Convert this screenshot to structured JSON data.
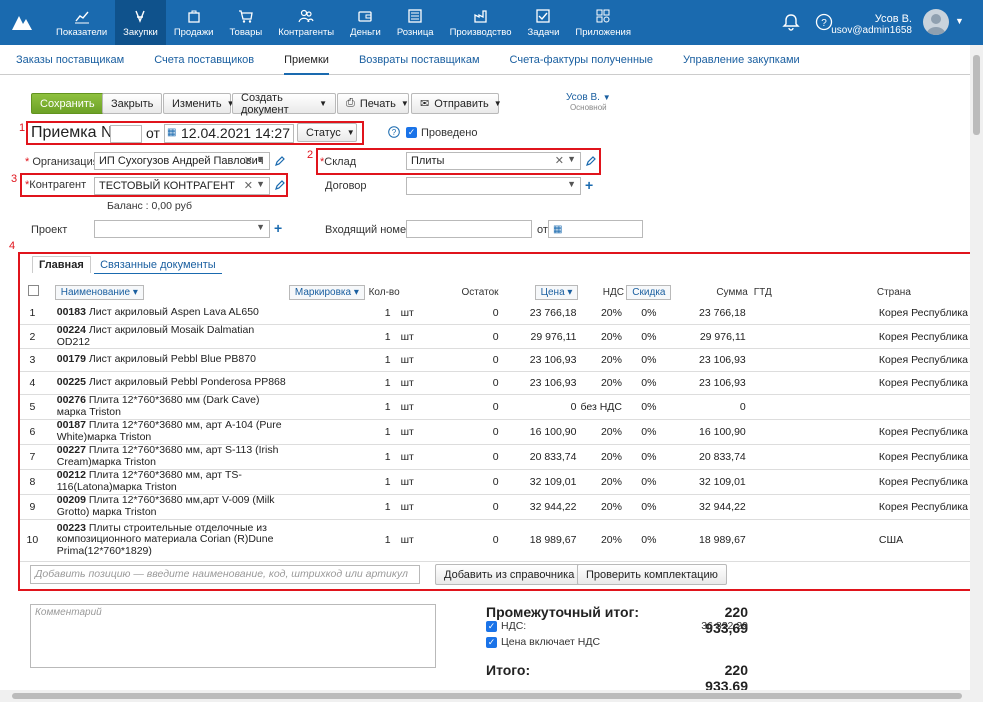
{
  "nav": {
    "items": [
      {
        "label": "Показатели",
        "icon": "chart-icon"
      },
      {
        "label": "Закупки",
        "icon": "purchases-icon"
      },
      {
        "label": "Продажи",
        "icon": "bag-icon"
      },
      {
        "label": "Товары",
        "icon": "cart-icon"
      },
      {
        "label": "Контрагенты",
        "icon": "people-icon"
      },
      {
        "label": "Деньги",
        "icon": "wallet-icon"
      },
      {
        "label": "Розница",
        "icon": "register-icon"
      },
      {
        "label": "Производство",
        "icon": "factory-icon"
      },
      {
        "label": "Задачи",
        "icon": "tasks-icon"
      },
      {
        "label": "Приложения",
        "icon": "apps-icon"
      }
    ],
    "active_index": 1,
    "user_name": "Усов В.",
    "user_login": "usov@admin1658",
    "accent": "#1a6aaf"
  },
  "subnav": [
    "Заказы поставщикам",
    "Счета поставщиков",
    "Приемки",
    "Возвраты поставщикам",
    "Счета-фактуры полученные",
    "Управление закупками"
  ],
  "toolbar": {
    "save": "Сохранить",
    "close": "Закрыть",
    "change": "Изменить",
    "create_doc": "Создать документ",
    "print": "Печать",
    "send": "Отправить",
    "user": "Усов В.",
    "user_sub": "Основной"
  },
  "markers": [
    "1",
    "2",
    "3",
    "4"
  ],
  "doc": {
    "title": "Приемка №",
    "number": "",
    "from": "от",
    "date": "12.04.2021 14:27",
    "status": "Статус",
    "posted": "Проведено",
    "org_label": "Организация",
    "org_value": "ИП Сухогузов Андрей Павлович",
    "warehouse_label": "Склад",
    "warehouse_value": "Плиты",
    "contractor_label": "Контрагент",
    "contractor_value": "ТЕСТОВЫЙ КОНТРАГЕНТ",
    "contract_label": "Договор",
    "contract_value": "",
    "balance": "Баланс : 0,00 руб",
    "project_label": "Проект",
    "project_value": "",
    "incoming_label": "Входящий номер",
    "incoming_value": "",
    "incoming_from": "от"
  },
  "tabs": [
    "Главная",
    "Связанные документы"
  ],
  "table": {
    "headers": {
      "name": "Наименование",
      "marking": "Маркировка",
      "qty": "Кол-во",
      "rest": "Остаток",
      "price": "Цена",
      "vat": "НДС",
      "discount": "Скидка",
      "sum": "Сумма",
      "gtd": "ГТД",
      "country": "Страна"
    },
    "rows": [
      {
        "n": "1",
        "code": "00183",
        "name": "Лист акриловый Aspen Lava AL650",
        "qty": "1",
        "unit": "шт",
        "rest": "0",
        "price": "23 766,18",
        "vat": "20%",
        "disc": "0%",
        "sum": "23 766,18",
        "country": "Корея Республика"
      },
      {
        "n": "2",
        "code": "00224",
        "name": "Лист акриловый Mosaik Dalmatian OD212",
        "qty": "1",
        "unit": "шт",
        "rest": "0",
        "price": "29 976,11",
        "vat": "20%",
        "disc": "0%",
        "sum": "29 976,11",
        "country": "Корея Республика"
      },
      {
        "n": "3",
        "code": "00179",
        "name": "Лист акриловый Pebbl Blue PB870",
        "qty": "1",
        "unit": "шт",
        "rest": "0",
        "price": "23 106,93",
        "vat": "20%",
        "disc": "0%",
        "sum": "23 106,93",
        "country": "Корея Республика"
      },
      {
        "n": "4",
        "code": "00225",
        "name": "Лист акриловый Pebbl Ponderosa PP868",
        "qty": "1",
        "unit": "шт",
        "rest": "0",
        "price": "23 106,93",
        "vat": "20%",
        "disc": "0%",
        "sum": "23 106,93",
        "country": "Корея Республика"
      },
      {
        "n": "5",
        "code": "00276",
        "name": "Плита 12*760*3680 мм (Dark Cave) марка Triston",
        "qty": "1",
        "unit": "шт",
        "rest": "0",
        "price": "0",
        "vat": "без НДС",
        "disc": "0%",
        "sum": "0",
        "country": ""
      },
      {
        "n": "6",
        "code": "00187",
        "name": "Плита 12*760*3680 мм, арт А-104 (Pure White)марка Triston",
        "qty": "1",
        "unit": "шт",
        "rest": "0",
        "price": "16 100,90",
        "vat": "20%",
        "disc": "0%",
        "sum": "16 100,90",
        "country": "Корея Республика"
      },
      {
        "n": "7",
        "code": "00227",
        "name": "Плита 12*760*3680 мм, арт S-113 (Irish Cream)марка Triston",
        "qty": "1",
        "unit": "шт",
        "rest": "0",
        "price": "20 833,74",
        "vat": "20%",
        "disc": "0%",
        "sum": "20 833,74",
        "country": "Корея Республика"
      },
      {
        "n": "8",
        "code": "00212",
        "name": "Плита 12*760*3680 мм, арт TS-116(Latona)марка Triston",
        "qty": "1",
        "unit": "шт",
        "rest": "0",
        "price": "32 109,01",
        "vat": "20%",
        "disc": "0%",
        "sum": "32 109,01",
        "country": "Корея Республика"
      },
      {
        "n": "9",
        "code": "00209",
        "name": "Плита 12*760*3680 мм,арт V-009 (Milk Grotto) марка Triston",
        "qty": "1",
        "unit": "шт",
        "rest": "0",
        "price": "32 944,22",
        "vat": "20%",
        "disc": "0%",
        "sum": "32 944,22",
        "country": "Корея Республика"
      },
      {
        "n": "10",
        "code": "00223",
        "name": "Плиты строительные отделочные из композиционного материала Corian (R)Dune Prima(12*760*1829)",
        "qty": "1",
        "unit": "шт",
        "rest": "0",
        "price": "18 989,67",
        "vat": "20%",
        "disc": "0%",
        "sum": "18 989,67",
        "country": "США"
      }
    ],
    "add_placeholder": "Добавить позицию — введите наименование, код, штрихкод или артикул",
    "add_from_catalog": "Добавить из справочника",
    "check_kit": "Проверить комплектацию"
  },
  "footer": {
    "comment_placeholder": "Комментарий",
    "subtotal_label": "Промежуточный итог:",
    "subtotal": "220 933,69",
    "vat_label": "НДС:",
    "vat": "36 822,29",
    "price_incl_vat": "Цена включает НДС",
    "total_label": "Итого:",
    "total": "220 933,69"
  }
}
